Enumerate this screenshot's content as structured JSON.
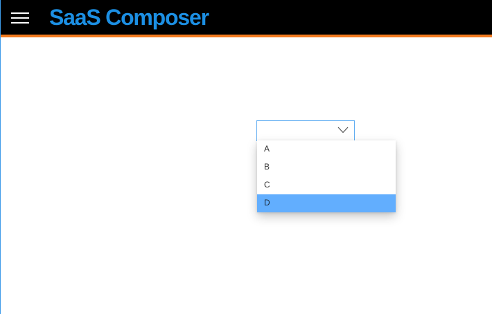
{
  "header": {
    "menu_icon": "hamburger-menu-icon",
    "title": "SaaS Composer",
    "colors": {
      "background": "#000000",
      "accent_border": "#f37b20",
      "title": "#1c8fe3"
    }
  },
  "dropdown": {
    "value": "",
    "options": [
      {
        "label": "A",
        "selected": false
      },
      {
        "label": "B",
        "selected": false
      },
      {
        "label": "C",
        "selected": false
      },
      {
        "label": "D",
        "selected": true
      }
    ],
    "icon": "chevron-down-icon",
    "colors": {
      "border": "#62aef2",
      "highlight": "#62aefe"
    }
  }
}
